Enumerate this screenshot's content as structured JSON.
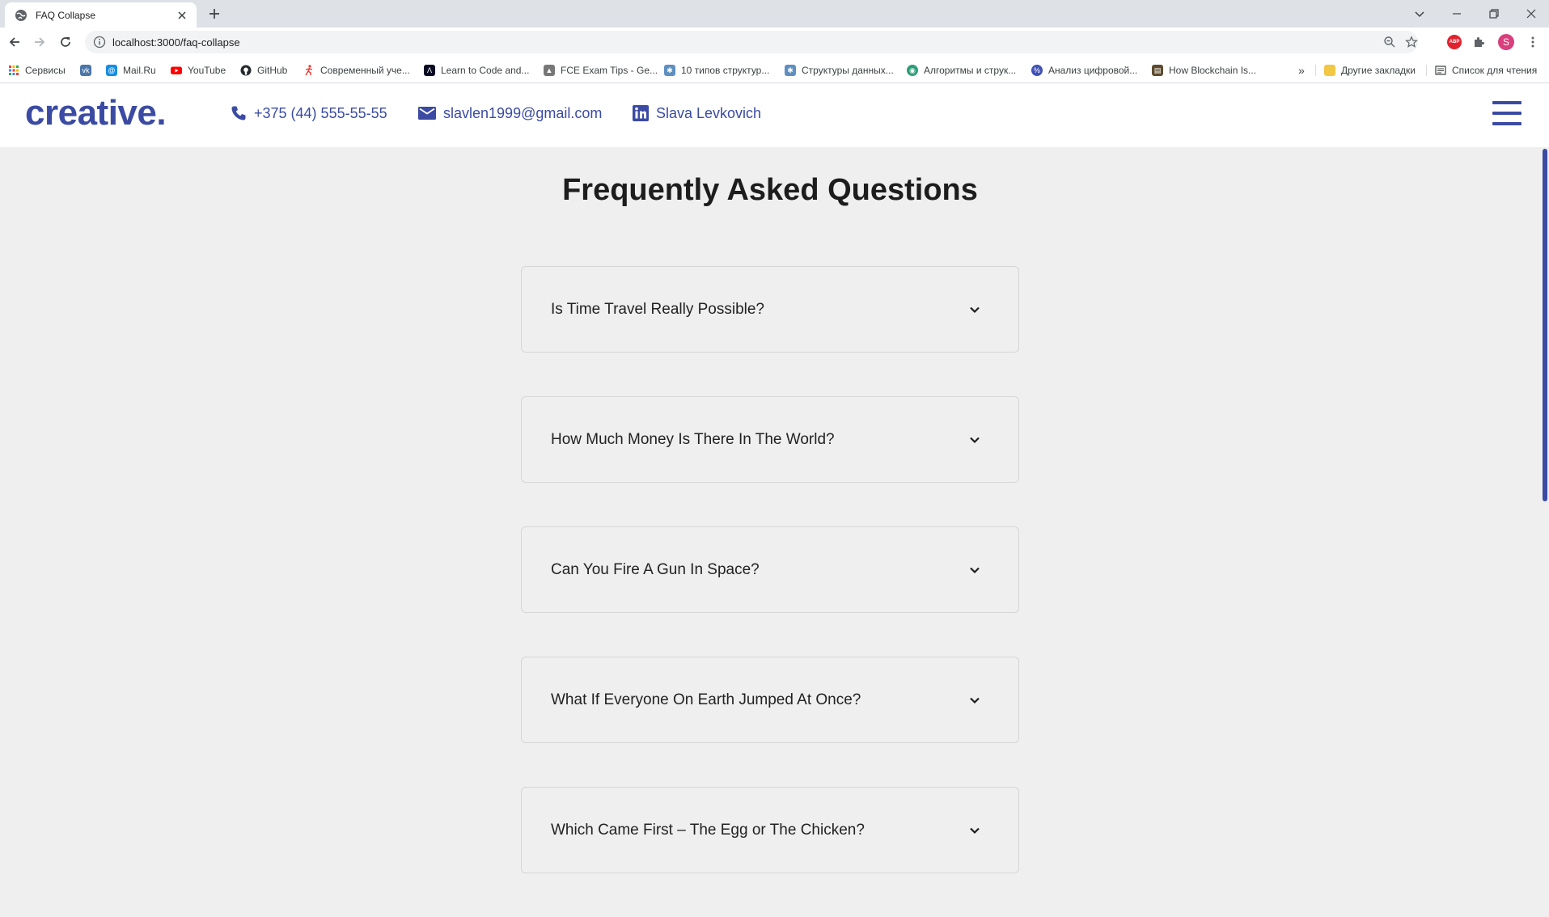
{
  "browser": {
    "tab_title": "FAQ Collapse",
    "url": "localhost:3000/faq-collapse",
    "profile_initial": "S",
    "abp_label": "ABP",
    "bookmarks": [
      {
        "label": "Сервисы",
        "icon": "apps-grid-icon",
        "color": "#e8453c"
      },
      {
        "label": "",
        "icon": "vk-icon",
        "color": "#4a76a8"
      },
      {
        "label": "Mail.Ru",
        "icon": "mailru-icon",
        "color": "#168de2"
      },
      {
        "label": "YouTube",
        "icon": "youtube-icon",
        "color": "#ff0000"
      },
      {
        "label": "GitHub",
        "icon": "github-icon",
        "color": "#24292e"
      },
      {
        "label": "Современный уче...",
        "icon": "runner-icon",
        "color": "#e53935"
      },
      {
        "label": "Learn to Code and...",
        "icon": "freecodecamp-icon",
        "color": "#0a0a23"
      },
      {
        "label": "FCE Exam Tips - Ge...",
        "icon": "hat-icon",
        "color": "#555555"
      },
      {
        "label": "10 типов структур...",
        "icon": "habr-icon",
        "color": "#5e8fc0"
      },
      {
        "label": "Структуры данных...",
        "icon": "habr-icon",
        "color": "#5e8fc0"
      },
      {
        "label": "Алгоритмы и струк...",
        "icon": "globe-icon",
        "color": "#2d9d78"
      },
      {
        "label": "Анализ цифровой...",
        "icon": "percent-icon",
        "color": "#3f51b5"
      },
      {
        "label": "How Blockchain Is...",
        "icon": "book-icon",
        "color": "#5d4a2e"
      }
    ],
    "more_label": "»",
    "other_bookmarks": "Другие закладки",
    "reading_list": "Список для чтения"
  },
  "site": {
    "logo": "creative.",
    "phone": "+375 (44) 555-55-55",
    "email": "slavlen1999@gmail.com",
    "linkedin": "Slava Levkovich"
  },
  "faq": {
    "title": "Frequently Asked Questions",
    "items": [
      {
        "question": "Is Time Travel Really Possible?"
      },
      {
        "question": "How Much Money Is There In The World?"
      },
      {
        "question": "Can You Fire A Gun In Space?"
      },
      {
        "question": "What If Everyone On Earth Jumped At Once?"
      },
      {
        "question": "Which Came First – The Egg or The Chicken?"
      }
    ]
  },
  "colors": {
    "brand": "#3b4ba3",
    "page_background": "#efefef",
    "text": "#222222"
  }
}
